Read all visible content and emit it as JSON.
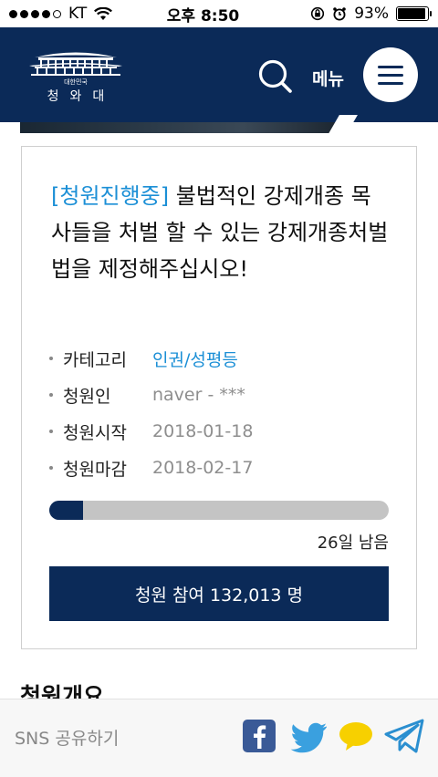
{
  "status_bar": {
    "carrier": "KT",
    "time": "오후 8:50",
    "battery": "93%",
    "battery_level": 0.93
  },
  "header": {
    "logo": {
      "subtitle": "대한민국",
      "title": "청와대"
    },
    "search_icon": "search-icon",
    "menu_label": "메뉴",
    "menu_icon": "hamburger-icon",
    "background_color": "#0b2a58"
  },
  "petition": {
    "status_label": "[청원진행중]",
    "title": "불법적인 강제개종 목사들을 처벌 할 수 있는 강제개종처벌법을 제정해주십시오!",
    "info": [
      {
        "label": "카테고리",
        "value": "인권/성평등"
      },
      {
        "label": "청원인",
        "value": "naver - ***"
      },
      {
        "label": "청원시작",
        "value": "2018-01-18"
      },
      {
        "label": "청원마감",
        "value": "2018-02-17"
      }
    ],
    "progress_fraction": 0.1,
    "remaining_text": "26일 남음",
    "join_button_label": "청원 참여 132,013 명",
    "accent_color": "#1b8fd6"
  },
  "section": {
    "heading": "청원개요"
  },
  "share": {
    "label": "SNS 공유하기",
    "icons": [
      "facebook-icon",
      "twitter-icon",
      "kakaotalk-icon",
      "telegram-icon"
    ]
  }
}
